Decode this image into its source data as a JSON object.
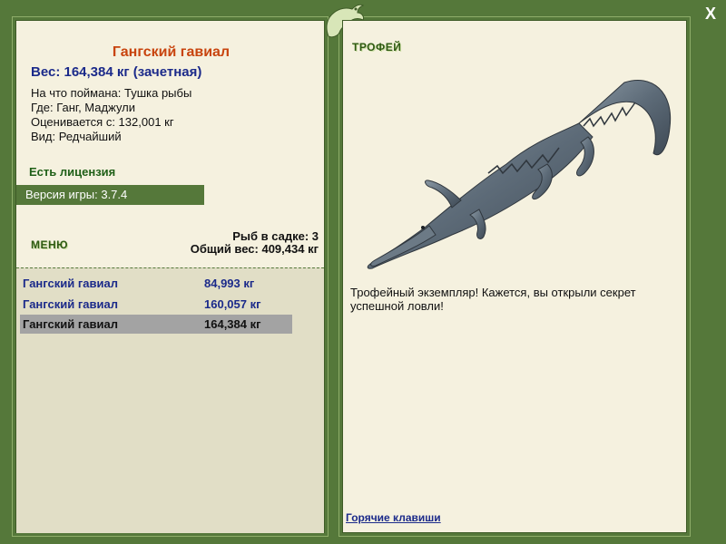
{
  "fish": {
    "title": "Гангский гавиал",
    "weight_line": "Вес: 164,384 кг (зачетная)",
    "caught_with": "На что поймана: Тушка рыбы",
    "where": "Где: Ганг, Маджули",
    "valued_from": "Оценивается с: 132,001 кг",
    "kind": "Вид: Редчайший"
  },
  "license": "Есть лицензия",
  "version": "Версия игры: 3.7.4",
  "menu_label": "МЕНЮ",
  "keepnet": {
    "count_line": "Рыб в садке: 3",
    "total_line": "Общий вес: 409,434 кг"
  },
  "catch_list": [
    {
      "name": "Гангский гавиал",
      "weight": "84,993 кг"
    },
    {
      "name": "Гангский гавиал",
      "weight": "160,057 кг"
    },
    {
      "name": "Гангский гавиал",
      "weight": "164,384 кг"
    }
  ],
  "selected_index": 2,
  "trophy": {
    "label": "ТРОФЕЙ",
    "text": "Трофейный экземпляр! Кажется, вы открыли секрет успешной ловли!"
  },
  "hotkeys_label": "Горячие клавиши",
  "close_label": "X",
  "colors": {
    "frame": "#55783a",
    "panel": "#f5f1df",
    "title": "#c8440e",
    "link": "#1b2a8a",
    "license": "#1f5f17"
  }
}
